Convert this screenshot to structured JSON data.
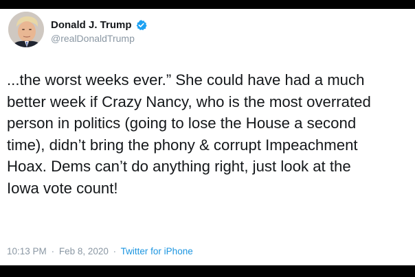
{
  "tweet": {
    "author": {
      "display_name": "Donald J. Trump",
      "handle": "@realDonaldTrump",
      "verified": true
    },
    "text": "...the worst weeks ever.” She could have had a much\nbetter week if Crazy Nancy, who is the most overrated\nperson in politics (going to lose the House a second\ntime), didn’t bring the phony & corrupt Impeachment\nHoax. Dems can’t do anything right, just look at the\nIowa vote count!",
    "time": "10:13 PM",
    "separator": "·",
    "date": "Feb 8, 2020",
    "source": "Twitter for iPhone"
  },
  "colors": {
    "background": "#000000",
    "card": "#ffffff",
    "text": "#14171a",
    "muted": "#8a97a3",
    "link": "#1b95e0",
    "verified": "#1da1f2"
  },
  "icons": {
    "verified": "verified-badge-icon",
    "avatar": "profile-photo"
  }
}
